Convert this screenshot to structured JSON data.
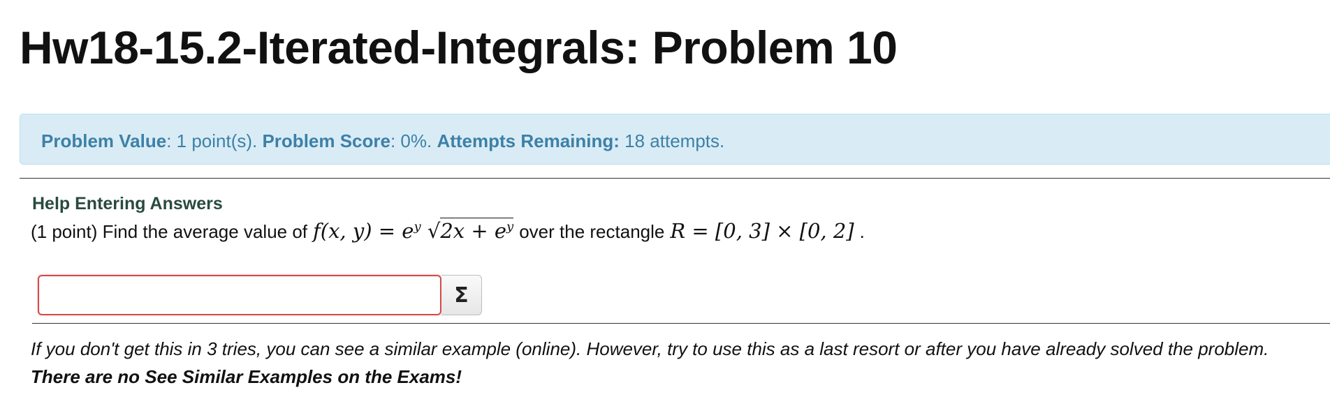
{
  "page": {
    "title": "Hw18-15.2-Iterated-Integrals: Problem 10"
  },
  "info": {
    "value_label": "Problem Value",
    "value_text": ": 1 point(s). ",
    "score_label": "Problem Score",
    "score_text": ": 0%. ",
    "attempts_label": "Attempts Remaining:",
    "attempts_text": " 18 attempts."
  },
  "help": {
    "link_label": "Help Entering Answers"
  },
  "problem": {
    "prefix": "(1 point) Find the average value of",
    "function_lhs": "f(x, y) = e",
    "exp_y": "y",
    "sqrt_symbol": "√",
    "sqrt_body_a": "2x + e",
    "sqrt_exp": "y",
    "middle": "over the rectangle",
    "region": "R = [0, 3] × [0, 2]",
    "suffix": "."
  },
  "answer": {
    "value": "",
    "placeholder": "",
    "equation_button_label": "Σ"
  },
  "note": {
    "italic_text": "If you don't get this in 3 tries, you can see a similar example (online). However, try to use this as a last resort or after you have already solved the problem. ",
    "bold_text": "There are no See Similar Examples on the Exams!"
  }
}
